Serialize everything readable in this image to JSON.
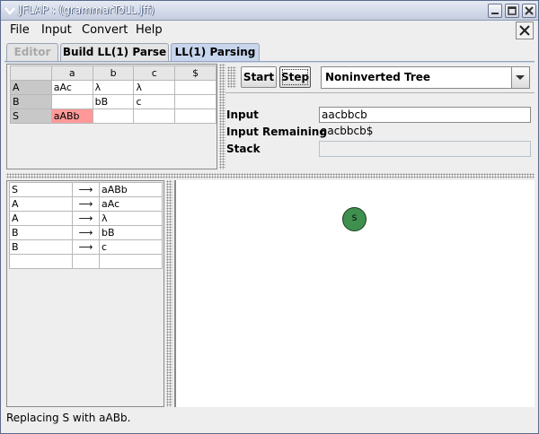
{
  "window": {
    "title": "JFLAP : (grammarToLL.jff)"
  },
  "menubar": {
    "items": [
      "File",
      "Input",
      "Convert",
      "Help"
    ]
  },
  "tabs": [
    {
      "label": "Editor",
      "state": "disabled"
    },
    {
      "label": "Build LL(1) Parse",
      "state": "normal"
    },
    {
      "label": "LL(1) Parsing",
      "state": "active"
    }
  ],
  "parse_table": {
    "columns": [
      "",
      "a",
      "b",
      "c",
      "$"
    ],
    "rows": [
      [
        "A",
        "aAc",
        "λ",
        "λ",
        ""
      ],
      [
        "B",
        "",
        "bB",
        "c",
        ""
      ],
      [
        "S",
        "aABb",
        "",
        "",
        ""
      ]
    ],
    "highlighted_cell": {
      "row": 2,
      "col": 1
    }
  },
  "controls": {
    "start_label": "Start",
    "step_label": "Step",
    "view_mode": "Noninverted Tree"
  },
  "fields": {
    "input_label": "Input",
    "input_value": "aacbbcb",
    "remaining_label": "Input Remaining",
    "remaining_value": "aacbbcb$",
    "stack_label": "Stack",
    "stack_value": ""
  },
  "productions": [
    {
      "lhs": "S",
      "rhs": "aABb"
    },
    {
      "lhs": "A",
      "rhs": "aAc"
    },
    {
      "lhs": "A",
      "rhs": "λ"
    },
    {
      "lhs": "B",
      "rhs": "bB"
    },
    {
      "lhs": "B",
      "rhs": "c"
    },
    {
      "lhs": "",
      "rhs": ""
    }
  ],
  "tree": {
    "root_label": "S",
    "node_color": "#3f8f4f"
  },
  "status": {
    "message": "Replacing S with aABb."
  },
  "colors": {
    "highlight": "#ff9999",
    "active_tab": "#c7d6ec"
  }
}
